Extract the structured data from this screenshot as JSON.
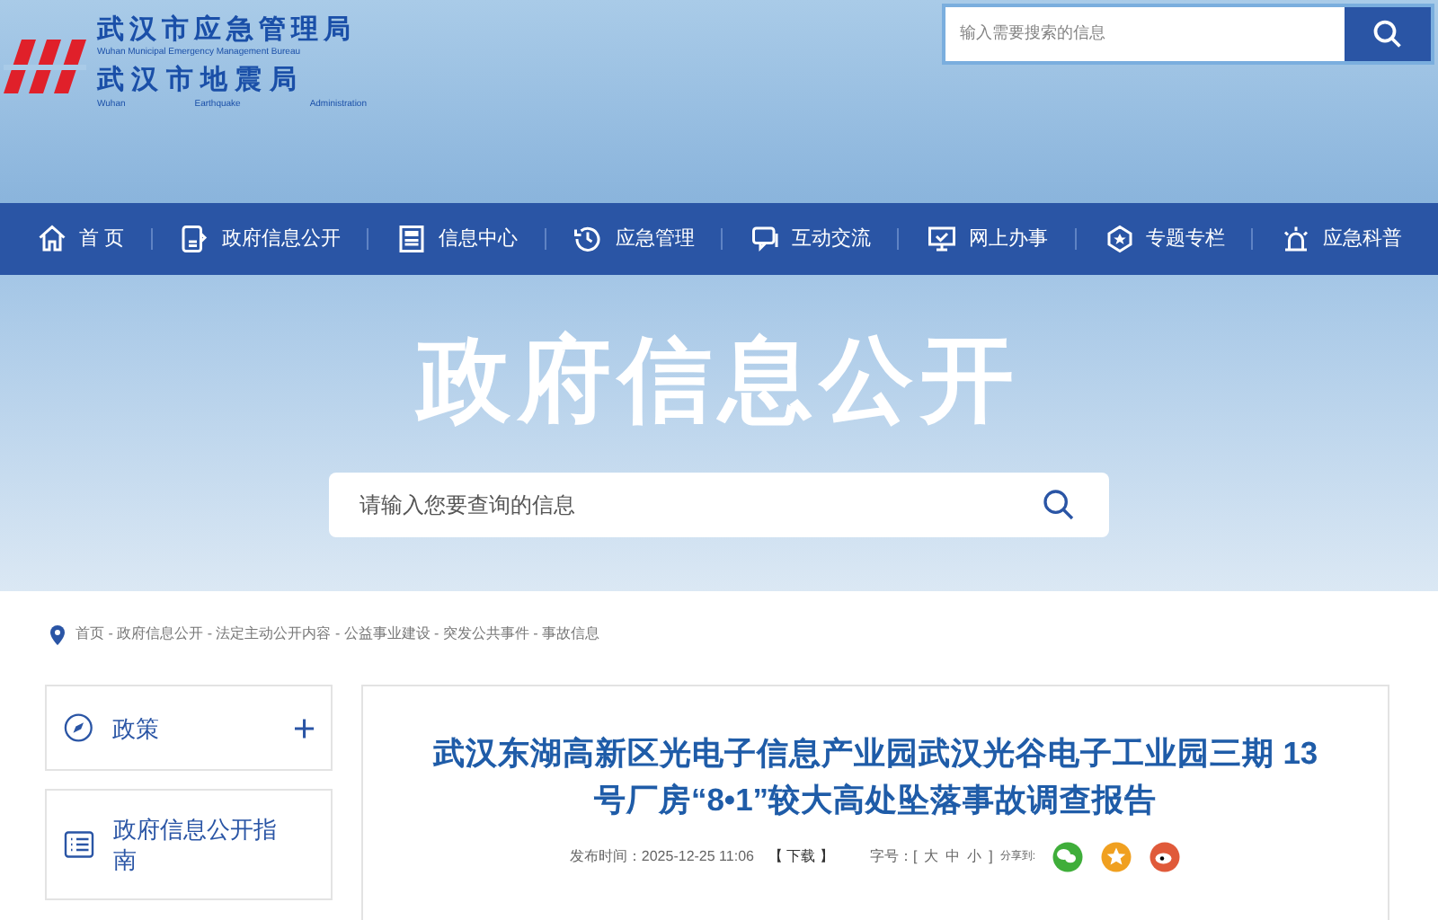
{
  "header": {
    "org_name": "武汉市应急管理局",
    "org_name_en": "Wuhan Municipal Emergency Management Bureau",
    "org_name_2": "武 汉 市 地 震 局",
    "org_name_2_en": [
      "Wuhan",
      "Earthquake",
      "Administration"
    ],
    "search": {
      "placeholder": "输入需要搜索的信息"
    }
  },
  "nav": [
    {
      "label": "首 页"
    },
    {
      "label": "政府信息公开"
    },
    {
      "label": "信息中心"
    },
    {
      "label": "应急管理"
    },
    {
      "label": "互动交流"
    },
    {
      "label": "网上办事"
    },
    {
      "label": "专题专栏"
    },
    {
      "label": "应急科普"
    }
  ],
  "banner": {
    "title": "政府信息公开",
    "search": {
      "placeholder": "请输入您要查询的信息"
    }
  },
  "breadcrumb": "首页 - 政府信息公开 - 法定主动公开内容 - 公益事业建设 - 突发公共事件 - 事故信息",
  "sidebar": [
    {
      "label": "政策",
      "expandable": true
    },
    {
      "label": "政府信息公开指南",
      "expandable": false
    }
  ],
  "article": {
    "title": "武汉东湖高新区光电子信息产业园武汉光谷电子工业园三期 13 号厂房“8•1”较大高处坠落事故调查报告",
    "published": "发布时间：2025-12-25 11:06",
    "download": "【 下载 】",
    "font_size_label": "字号：[",
    "font_sizes": [
      "大",
      "中",
      "小"
    ],
    "font_size_end": "]",
    "share_label": "分享到:",
    "share": [
      {
        "kind": "wechat",
        "color": "#3fae3a"
      },
      {
        "kind": "star",
        "color": "#f0a020"
      },
      {
        "kind": "weibo",
        "color": "#e05a3a"
      }
    ]
  }
}
